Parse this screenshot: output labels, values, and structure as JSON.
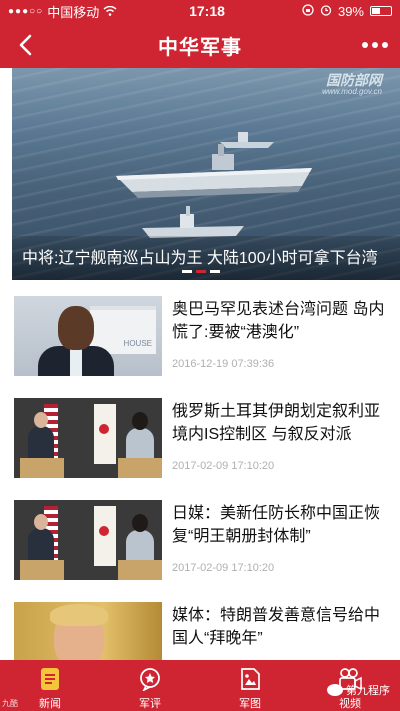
{
  "status_bar": {
    "carrier": "中国移动",
    "time": "17:18",
    "battery": "39%"
  },
  "nav": {
    "title": "中华军事"
  },
  "banner": {
    "watermark": "国防部网",
    "watermark_url": "www.mod.gov.cn",
    "caption": "中将:辽宁舰南巡占山为王 大陆100小时可拿下台湾",
    "slide_count": 3,
    "active_slide": 2
  },
  "news": [
    {
      "title": "奥巴马罕见表述台湾问题 岛内慌了:要被“港澳化”",
      "date": "2016-12-19 07:39:36",
      "thumb": "obama"
    },
    {
      "title": "俄罗斯土耳其伊朗划定叙利亚境内IS控制区 与叙反对派",
      "date": "2017-02-09 17:10:20",
      "thumb": "meeting"
    },
    {
      "title": "日媒：美新任防长称中国正恢复“明王朝册封体制”",
      "date": "2017-02-09 17:10:20",
      "thumb": "meeting"
    },
    {
      "title": "媒体：特朗普发善意信号给中国人“拜晚年”",
      "date": "",
      "thumb": "trump"
    }
  ],
  "tabs": [
    {
      "label": "新闻",
      "icon": "news-icon",
      "active": true
    },
    {
      "label": "军评",
      "icon": "star-bubble-icon",
      "active": false
    },
    {
      "label": "军图",
      "icon": "image-icon",
      "active": false
    },
    {
      "label": "视频",
      "icon": "video-camera-icon",
      "active": false
    }
  ],
  "watermark_footer": "第九程序",
  "corner_text": "九酷",
  "colors": {
    "brand_red": "#cf2532",
    "active_icon": "#f4c53a",
    "date_gray": "#b0b0b0"
  }
}
